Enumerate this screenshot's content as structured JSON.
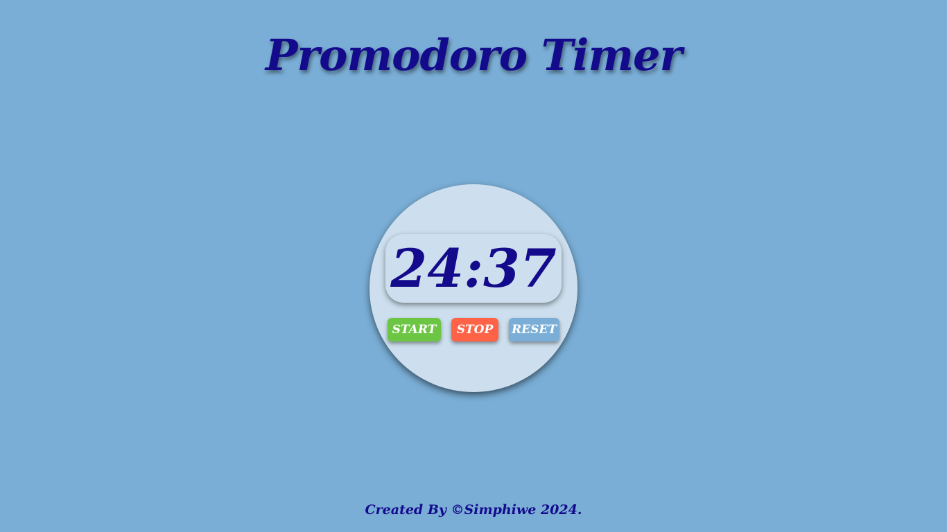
{
  "app": {
    "title": "Promodoro Timer"
  },
  "timer": {
    "display": "24:37"
  },
  "buttons": {
    "start_label": "START",
    "stop_label": "STOP",
    "reset_label": "RESET"
  },
  "footer": {
    "text": "Created By ©Simphiwe 2024."
  },
  "colors": {
    "background": "#7aaed6",
    "title_text": "#140a8c",
    "circle": "#cddfee",
    "start_button": "#6cc644",
    "stop_button": "#ff6347",
    "reset_button": "#7aaed6"
  }
}
